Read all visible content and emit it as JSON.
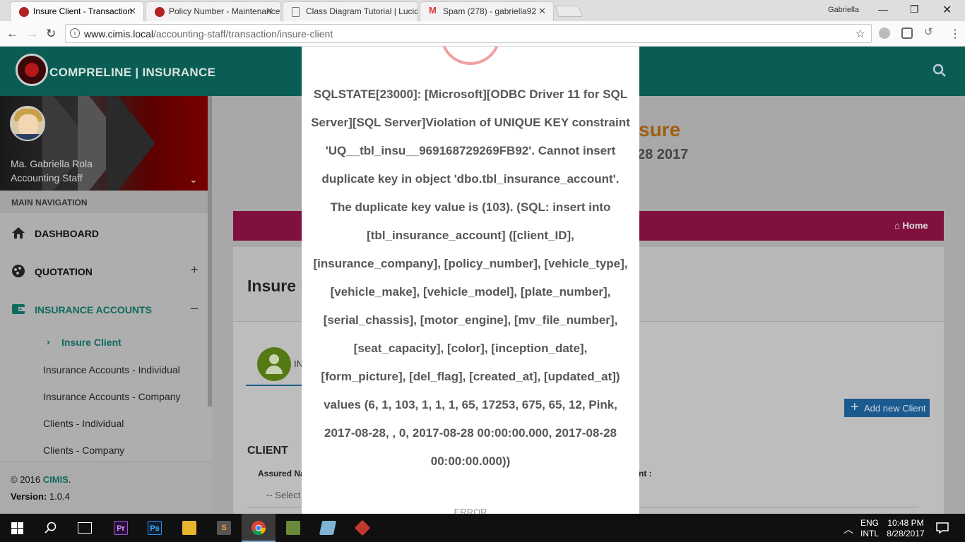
{
  "browser": {
    "tabs": [
      {
        "title": "Insure Client - Transaction",
        "favicon": "cimis-favicon"
      },
      {
        "title": "Policy Number - Maintenance",
        "favicon": "cimis-favicon"
      },
      {
        "title": "Class Diagram Tutorial | Lucidchart",
        "favicon": "page-icon"
      },
      {
        "title": "Spam (278) - gabriella92",
        "favicon": "gmail-icon"
      }
    ],
    "user": "Gabriella",
    "url_host": "www.cimis.local",
    "url_path": "/accounting-staff/transaction/insure-client"
  },
  "header": {
    "brand": "COMPRELINE | INSURANCE"
  },
  "profile": {
    "name": "Ma. Gabriella Rola",
    "role": "Accounting Staff"
  },
  "sidebar": {
    "section_title": "MAIN NAVIGATION",
    "items": [
      {
        "label": "DASHBOARD",
        "icon": "home-icon"
      },
      {
        "label": "QUOTATION",
        "icon": "palette-icon",
        "toggle": "+"
      },
      {
        "label": "INSURANCE ACCOUNTS",
        "icon": "wallet-icon",
        "toggle": "–"
      }
    ],
    "subitems": [
      {
        "label": "Insure Client",
        "active": true
      },
      {
        "label": "Insurance Accounts - Individual"
      },
      {
        "label": "Insurance Accounts - Company"
      },
      {
        "label": "Clients - Individual"
      },
      {
        "label": "Clients - Company"
      }
    ],
    "footer": {
      "copyright": "© 2016 ",
      "brand_link": "CIMIS",
      "brand_suffix": ".",
      "version_label": "Version:",
      "version": "1.0.4"
    }
  },
  "main": {
    "title_partial": "sure",
    "date_partial": "28 2017",
    "breadcrumb_home": "Home",
    "box_title_partial": "Insure I",
    "tab_label_partial": "IN",
    "add_button": "Add new Client",
    "client_header": "CLIENT",
    "assured_label": "Assured Na",
    "nt_label": "nt :",
    "select_placeholder": "-- Select"
  },
  "modal": {
    "message": "SQLSTATE[23000]: [Microsoft][ODBC Driver 11 for SQL Server][SQL Server]Violation of UNIQUE KEY constraint 'UQ__tbl_insu__969168729269FB92'. Cannot insert duplicate key in object 'dbo.tbl_insurance_account'. The duplicate key value is (103). (SQL: insert into [tbl_insurance_account] ([client_ID], [insurance_company], [policy_number], [vehicle_type], [vehicle_make], [vehicle_model], [plate_number], [serial_chassis], [motor_engine], [mv_file_number], [seat_capacity], [color], [inception_date], [form_picture], [del_flag], [created_at], [updated_at]) values (6, 1, 103, 1, 1, 1, 65, 17253, 675, 65, 12, Pink, 2017-08-28, , 0, 2017-08-28 00:00:00.000, 2017-08-28 00:00:00.000))",
    "label": "ERROR"
  },
  "taskbar": {
    "apps": [
      "Premiere",
      "Photoshop",
      "File Explorer",
      "Sublime Text",
      "Chrome",
      "Tools",
      "Notepad",
      "Git"
    ],
    "lang1": "ENG",
    "lang2": "INTL",
    "time": "10:48 PM",
    "date": "8/28/2017"
  },
  "colors": {
    "header": "#0a5d53",
    "accent_pink": "#80113f",
    "active_teal": "#0f6a5f",
    "add_button": "#1b5a8e"
  }
}
